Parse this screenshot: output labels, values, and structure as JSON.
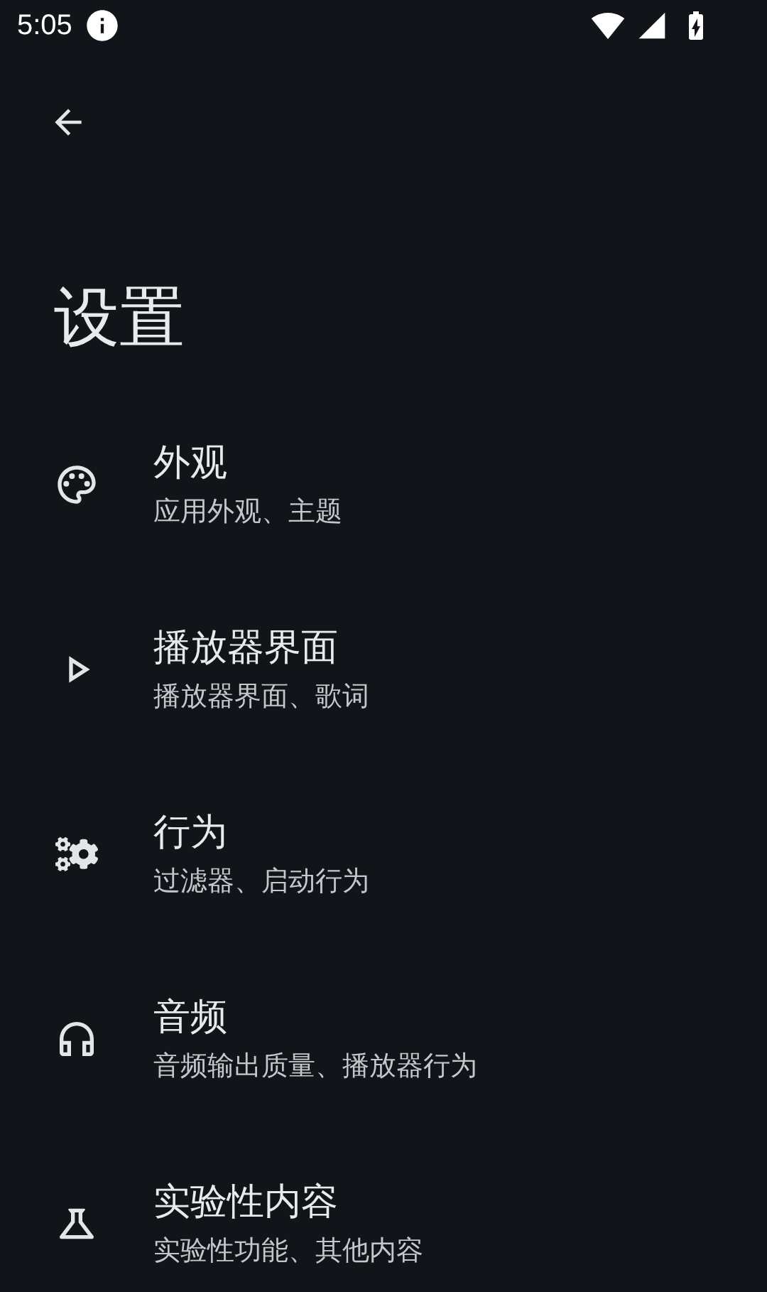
{
  "status_bar": {
    "time": "5:05"
  },
  "title": "设置",
  "items": [
    {
      "title": "外观",
      "subtitle": "应用外观、主题"
    },
    {
      "title": "播放器界面",
      "subtitle": "播放器界面、歌词"
    },
    {
      "title": "行为",
      "subtitle": "过滤器、启动行为"
    },
    {
      "title": "音频",
      "subtitle": "音频输出质量、播放器行为"
    },
    {
      "title": "实验性内容",
      "subtitle": "实验性功能、其他内容"
    }
  ]
}
